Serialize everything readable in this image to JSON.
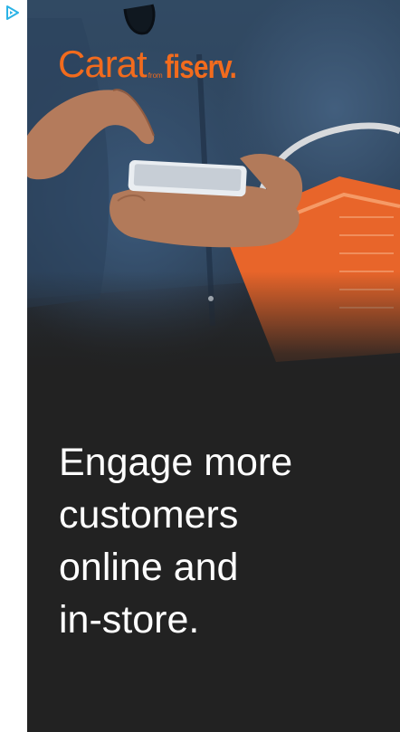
{
  "ad": {
    "adchoices_icon": "adchoices-play-icon",
    "adchoices_color": "#2bb3e6",
    "logo": {
      "carat": "Carat",
      "from": "from",
      "fiserv": "fiserv.",
      "color": "#f26b1d"
    },
    "headline_lines": [
      "Engage more",
      "customers",
      "online and",
      "in-store."
    ],
    "background_color": "#222222",
    "photo_description_icon": "hands-holding-smartphone-image"
  }
}
